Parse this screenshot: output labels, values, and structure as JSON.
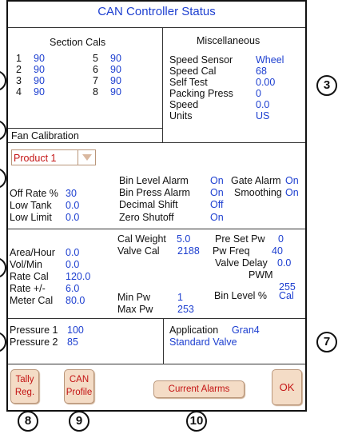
{
  "title": "CAN Controller Status",
  "section_cals": {
    "header": "Section Cals",
    "rows": [
      {
        "n1": "1",
        "v1": "90",
        "n2": "5",
        "v2": "90"
      },
      {
        "n1": "2",
        "v1": "90",
        "n2": "6",
        "v2": "90"
      },
      {
        "n1": "3",
        "v1": "90",
        "n2": "7",
        "v2": "90"
      },
      {
        "n1": "4",
        "v1": "90",
        "n2": "8",
        "v2": "90"
      }
    ]
  },
  "misc": {
    "header": "Miscellaneous",
    "rows": [
      {
        "label": "Speed Sensor",
        "value": "Wheel"
      },
      {
        "label": "Speed Cal",
        "value": "68"
      },
      {
        "label": "Self Test",
        "value": "0.00"
      },
      {
        "label": "Packing Press",
        "value": "0"
      },
      {
        "label": "Speed",
        "value": "0.0"
      },
      {
        "label": "Units",
        "value": "US"
      }
    ]
  },
  "fan_calibration": "Fan Calibration",
  "product_dropdown": {
    "value": "Product 1"
  },
  "product_left": [
    {
      "label": "Off Rate %",
      "value": "30"
    },
    {
      "label": "Low Tank",
      "value": "0.0"
    },
    {
      "label": "Low Limit",
      "value": "0.0"
    }
  ],
  "product_right": [
    {
      "label": "Bin Level Alarm",
      "value": "On"
    },
    {
      "label": "Bin Press Alarm",
      "value": "On"
    },
    {
      "label": "Decimal Shift",
      "value": "Off"
    },
    {
      "label": "Zero Shutoff",
      "value": "On"
    }
  ],
  "product_far": [
    {
      "label": "Gate Alarm",
      "value": "On"
    },
    {
      "label": "Smoothing",
      "value": "On"
    }
  ],
  "rate_left": [
    {
      "label": "Area/Hour",
      "value": "0.0"
    },
    {
      "label": "Vol/Min",
      "value": "0.0"
    },
    {
      "label": "Rate Cal",
      "value": "120.0"
    },
    {
      "label": "Rate +/-",
      "value": "6.0"
    },
    {
      "label": "Meter Cal",
      "value": "80.0"
    }
  ],
  "rate_mid": {
    "cal_weight": {
      "label": "Cal Weight",
      "value": "5.0"
    },
    "valve_cal": {
      "label": "Valve Cal",
      "value": "2188"
    },
    "min_pw": {
      "label": "Min Pw",
      "value": "1"
    },
    "max_pw": {
      "label": "Max Pw",
      "value": "253"
    }
  },
  "rate_right": [
    {
      "label": "Pre Set Pw",
      "value": "0"
    },
    {
      "label": "Pw Freq",
      "value": "40"
    },
    {
      "label": "Valve Delay",
      "value": "0.0"
    },
    {
      "label": "PWM",
      "value": "255"
    },
    {
      "label": "Bin Level %",
      "value": "Cal"
    }
  ],
  "pressure": [
    {
      "label": "Pressure 1",
      "value": "100"
    },
    {
      "label": "Pressure 2",
      "value": "85"
    }
  ],
  "application": {
    "label": "Application",
    "value": "Gran4",
    "valve": "Standard Valve"
  },
  "buttons": {
    "tally_line1": "Tally",
    "tally_line2": "Reg.",
    "can_line1": "CAN",
    "can_line2": "Profile",
    "current_alarms": "Current Alarms",
    "ok": "OK"
  },
  "callouts": {
    "c3": "3",
    "c7": "7",
    "c8": "8",
    "c9": "9",
    "c10": "10"
  }
}
